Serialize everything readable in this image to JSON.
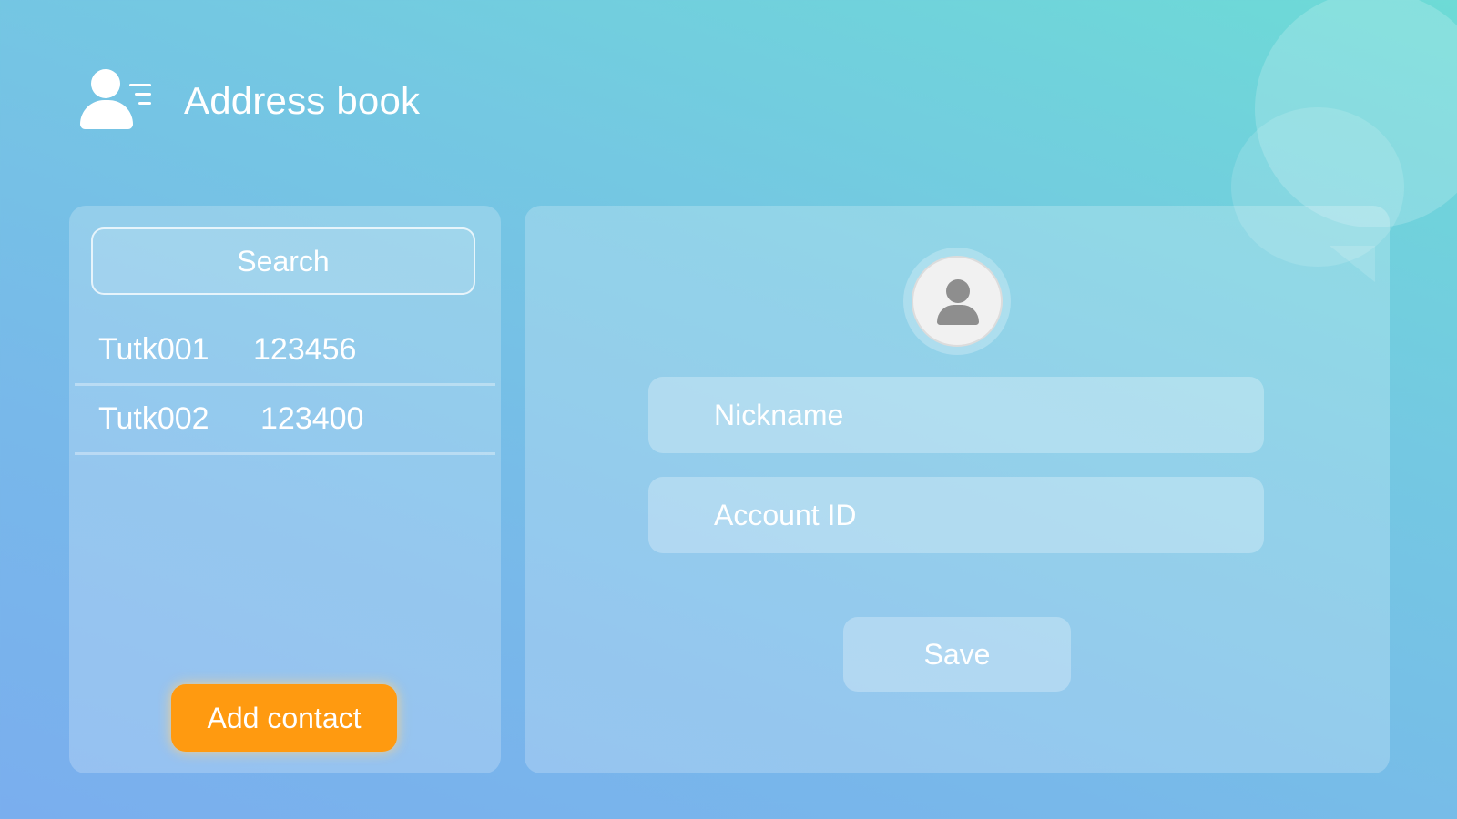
{
  "header": {
    "title": "Address book",
    "icon": "contacts-list-icon"
  },
  "search": {
    "label": "Search"
  },
  "contacts": [
    {
      "nickname": "Tutk001",
      "account_id": "123456"
    },
    {
      "nickname": "Tutk002",
      "account_id": "123400"
    }
  ],
  "left_panel": {
    "add_contact_label": "Add contact"
  },
  "form": {
    "avatar_icon": "user-avatar-icon",
    "nickname_placeholder": "Nickname",
    "account_id_placeholder": "Account ID",
    "save_label": "Save"
  },
  "colors": {
    "accent": "#ff9a10",
    "background_top": "#6ddbd6",
    "background_bottom": "#7aaeee"
  }
}
